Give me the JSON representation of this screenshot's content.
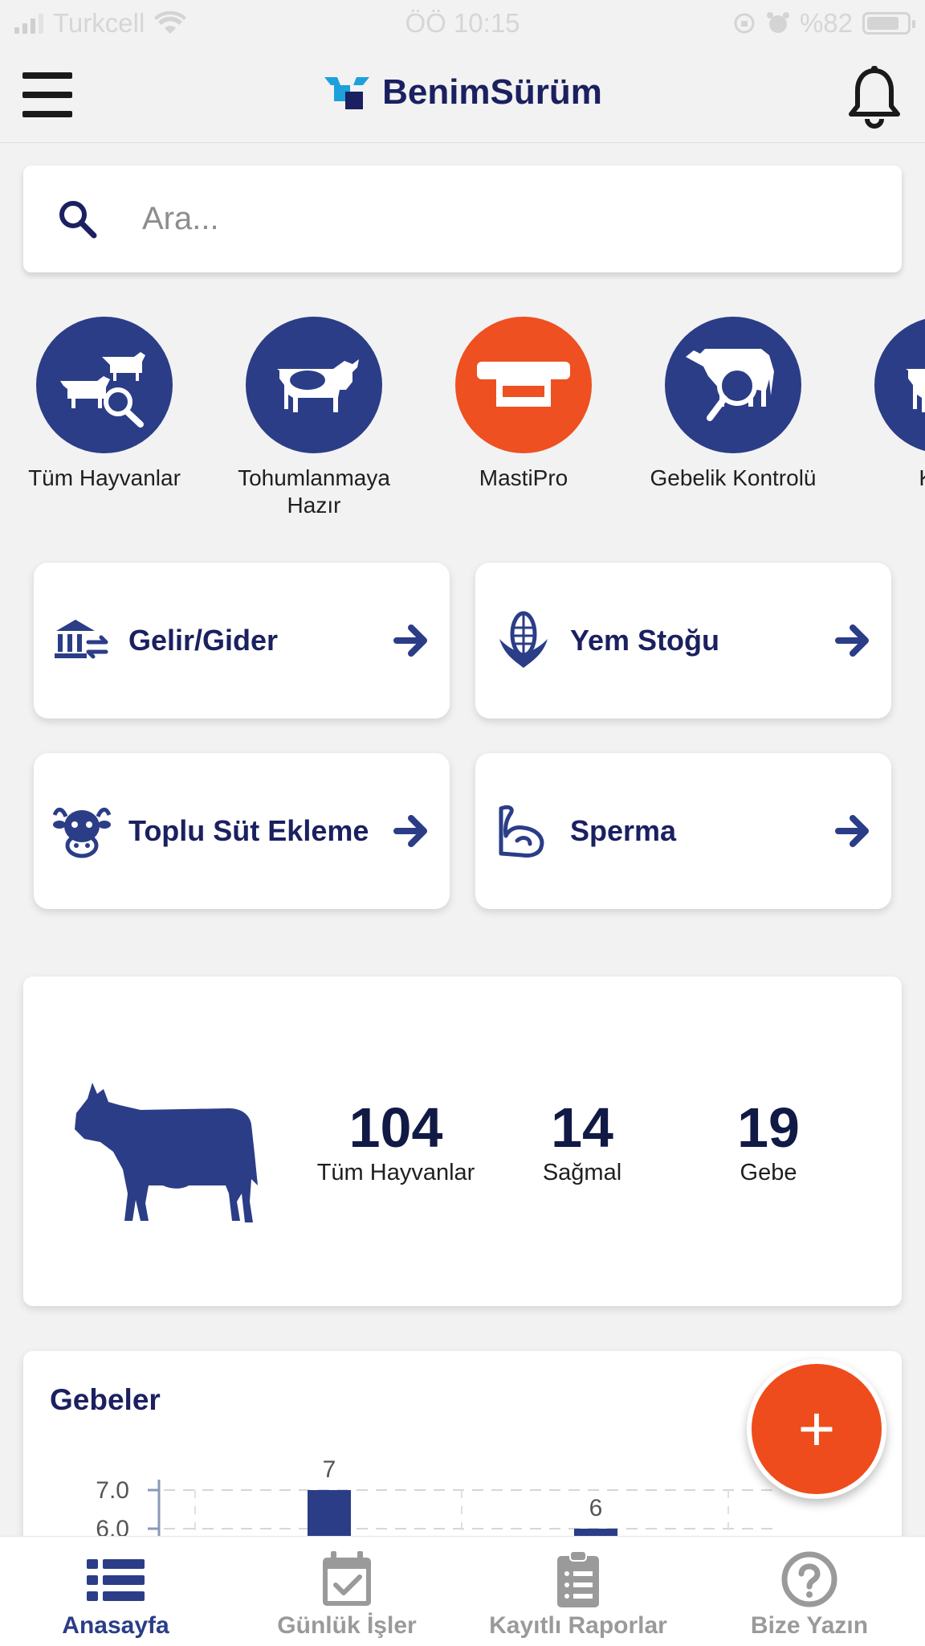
{
  "status_bar": {
    "carrier": "Turkcell",
    "time": "ÖÖ 10:15",
    "battery": "%82"
  },
  "header": {
    "title": "BenimSürüm"
  },
  "search": {
    "placeholder": "Ara..."
  },
  "categories": [
    {
      "label": "Tüm Hayvanlar",
      "icon": "herd-search-icon"
    },
    {
      "label": "Tohumlanmaya Hazır",
      "icon": "cow-icon"
    },
    {
      "label": "MastiPro",
      "icon": "mastipro-icon",
      "color": "#ee5022"
    },
    {
      "label": "Gebelik Kontrolü",
      "icon": "cow-magnify-icon"
    },
    {
      "label": "Kuru",
      "icon": "cow-icon"
    }
  ],
  "quick_links": [
    {
      "label": "Gelir/Gider",
      "icon": "bank-transfer-icon"
    },
    {
      "label": "Yem Stoğu",
      "icon": "corn-icon"
    },
    {
      "label": "Toplu Süt Ekleme",
      "icon": "cow-face-icon"
    },
    {
      "label": "Sperma",
      "icon": "arm-icon"
    }
  ],
  "stats": [
    {
      "value": "104",
      "label": "Tüm Hayvanlar"
    },
    {
      "value": "14",
      "label": "Sağmal"
    },
    {
      "value": "19",
      "label": "Gebe"
    }
  ],
  "chart_card": {
    "title": "Gebeler"
  },
  "chart_data": {
    "type": "bar",
    "title": "Gebeler",
    "y_ticks": [
      "7.0",
      "6.0"
    ],
    "values": [
      7,
      6
    ],
    "data_labels": [
      "7",
      "6"
    ],
    "color": "#2b3d87",
    "grid": true
  },
  "fab": {
    "label": "+"
  },
  "bottom_nav": [
    {
      "label": "Anasayfa",
      "icon": "list-icon",
      "active": true
    },
    {
      "label": "Günlük İşler",
      "icon": "calendar-check-icon",
      "active": false
    },
    {
      "label": "Kayıtlı Raporlar",
      "icon": "clipboard-list-icon",
      "active": false
    },
    {
      "label": "Bize Yazın",
      "icon": "help-circle-icon",
      "active": false
    }
  ],
  "colors": {
    "primary": "#2b3d87",
    "accent": "#ee5022"
  }
}
